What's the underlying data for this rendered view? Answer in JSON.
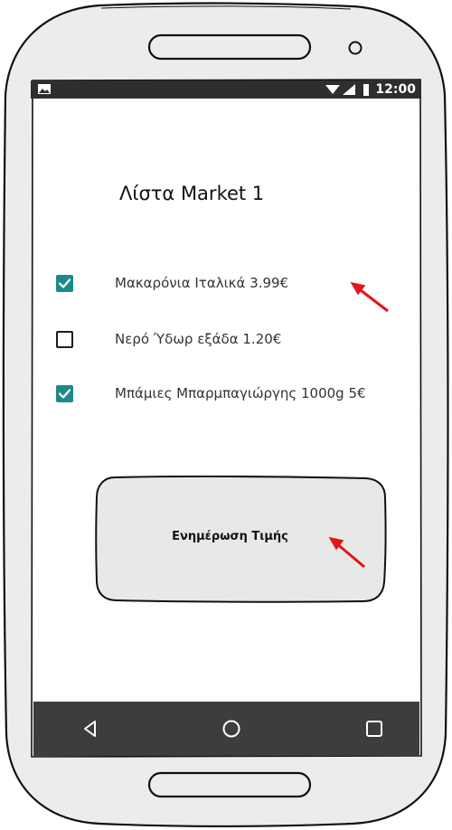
{
  "status_bar": {
    "time": "12:00",
    "icons": [
      "photo-icon",
      "wifi-icon",
      "signal-icon",
      "battery-icon"
    ]
  },
  "screen": {
    "title": "Λίστα Market 1"
  },
  "items": [
    {
      "label": "Μακαρόνια Ιταλικά 3.99€",
      "checked": true
    },
    {
      "label": "Νερό Ύδωρ εξάδα 1.20€",
      "checked": false
    },
    {
      "label": "Μπάμιες Μπαρμπαγιώργης 1000g 5€",
      "checked": true
    }
  ],
  "button": {
    "label": "Ενημέρωση Τιμής"
  },
  "nav": {
    "icons": [
      "back-icon",
      "home-icon",
      "recents-icon"
    ]
  },
  "colors": {
    "checkbox_checked": "#1d8a87",
    "status_bar": "#2e2e2e",
    "nav_bar": "#3d3d3d",
    "phone_body": "#ececec",
    "annotation_arrow": "#e3141a"
  }
}
